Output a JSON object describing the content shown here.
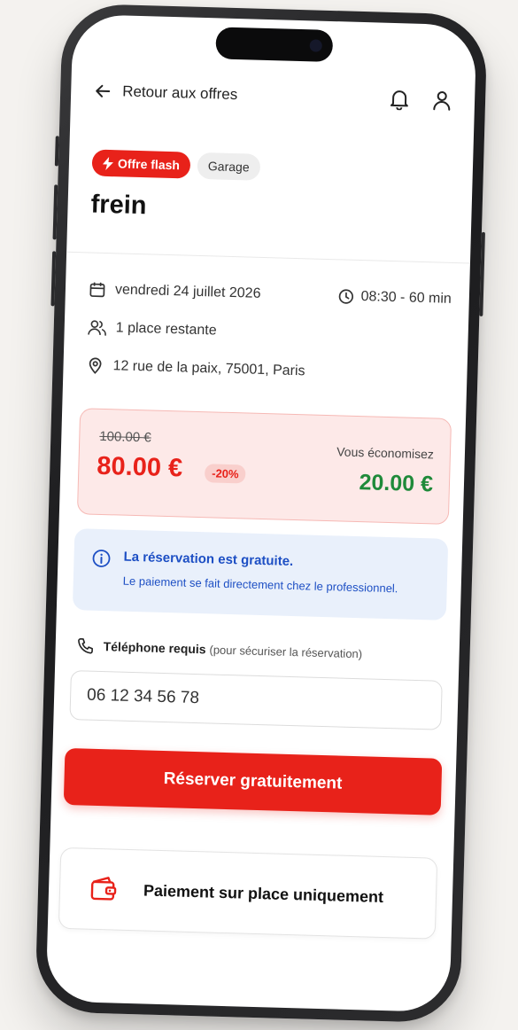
{
  "header": {
    "back_label": "Retour aux offres",
    "icons": [
      "back-arrow-icon",
      "bell-icon",
      "user-icon"
    ]
  },
  "offer": {
    "flash_badge": "Offre flash",
    "category_badge": "Garage",
    "title": "frein",
    "date": "vendredi 24 juillet 2026",
    "time": "08:30 - 60 min",
    "places": "1 place restante",
    "address": "12 rue de la paix, 75001, Paris"
  },
  "pricing": {
    "old_price": "100.00 €",
    "new_price": "80.00 €",
    "discount": "-20%",
    "savings_label": "Vous économisez",
    "savings_value": "20.00 €",
    "colors": {
      "accent": "#e8221a",
      "savings": "#1f8a3a"
    }
  },
  "info": {
    "title": "La réservation est gratuite.",
    "text": "Le paiement se fait directement chez le professionnel.",
    "color": "#1d4fc4"
  },
  "phone_field": {
    "label": "Téléphone requis",
    "hint": "(pour sécuriser la réservation)",
    "value": "06 12 34 56 78"
  },
  "actions": {
    "reserve_label": "Réserver gratuitement",
    "payment_label": "Paiement sur place uniquement"
  }
}
